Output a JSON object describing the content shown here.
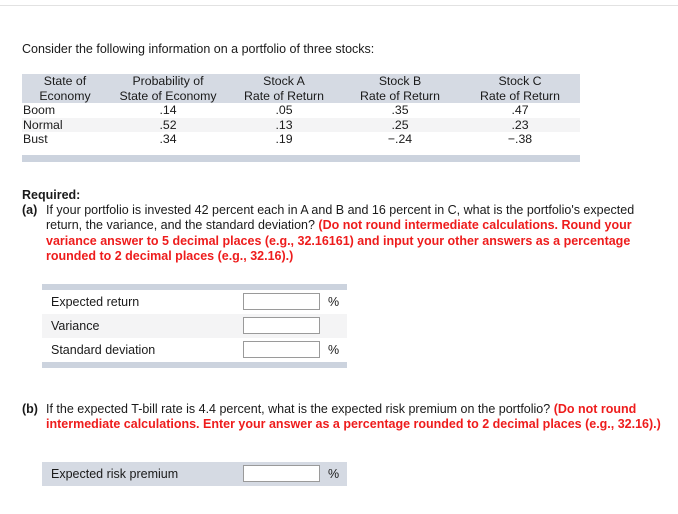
{
  "intro": {
    "text": "Consider the following information on a portfolio of three stocks:"
  },
  "table": {
    "headers": [
      {
        "line1": "State of",
        "line2": "Economy"
      },
      {
        "line1": "Probability of",
        "line2": "State of Economy"
      },
      {
        "line1": "Stock A",
        "line2": "Rate of Return"
      },
      {
        "line1": "Stock B",
        "line2": "Rate of Return"
      },
      {
        "line1": "Stock C",
        "line2": "Rate of Return"
      }
    ],
    "rows": [
      {
        "state": "Boom",
        "probability": ".14",
        "stock_a": ".05",
        "stock_b": ".35",
        "stock_c": ".47"
      },
      {
        "state": "Normal",
        "probability": ".52",
        "stock_a": ".13",
        "stock_b": ".25",
        "stock_c": ".23"
      },
      {
        "state": "Bust",
        "probability": ".34",
        "stock_a": ".19",
        "stock_b": "−.24",
        "stock_c": "−.38"
      }
    ]
  },
  "required": {
    "label": "Required:",
    "part_a": {
      "marker": "(a)",
      "black_text": "If your portfolio is invested 42 percent each in A and B and 16 percent in C, what is the portfolio's expected return, the variance, and the standard deviation? ",
      "red_text": "(Do not round intermediate calculations. Round your variance answer to 5 decimal places (e.g., 32.16161) and input your other answers as a percentage rounded to 2 decimal places (e.g., 32.16).)"
    },
    "part_b": {
      "marker": "(b)",
      "black_text": "If the expected T-bill rate is 4.4 percent, what is the expected risk premium on the portfolio? ",
      "red_text": "(Do not round intermediate calculations. Enter your answer as a percentage rounded to 2 decimal places (e.g., 32.16).)"
    }
  },
  "answers_a": [
    {
      "label": "Expected return",
      "value": "",
      "placeholder": "",
      "suffix": "%"
    },
    {
      "label": "Variance",
      "value": "",
      "placeholder": "",
      "suffix": ""
    },
    {
      "label": "Standard deviation",
      "value": "",
      "placeholder": "",
      "suffix": "%"
    }
  ],
  "answers_b": [
    {
      "label": "Expected risk premium",
      "value": "",
      "placeholder": "",
      "suffix": "%"
    }
  ],
  "colors": {
    "header_bar": "#d5dae3",
    "divider_bar": "#ccd3de",
    "stripe": "#f4f4f5",
    "red": "#ee1c1c"
  }
}
